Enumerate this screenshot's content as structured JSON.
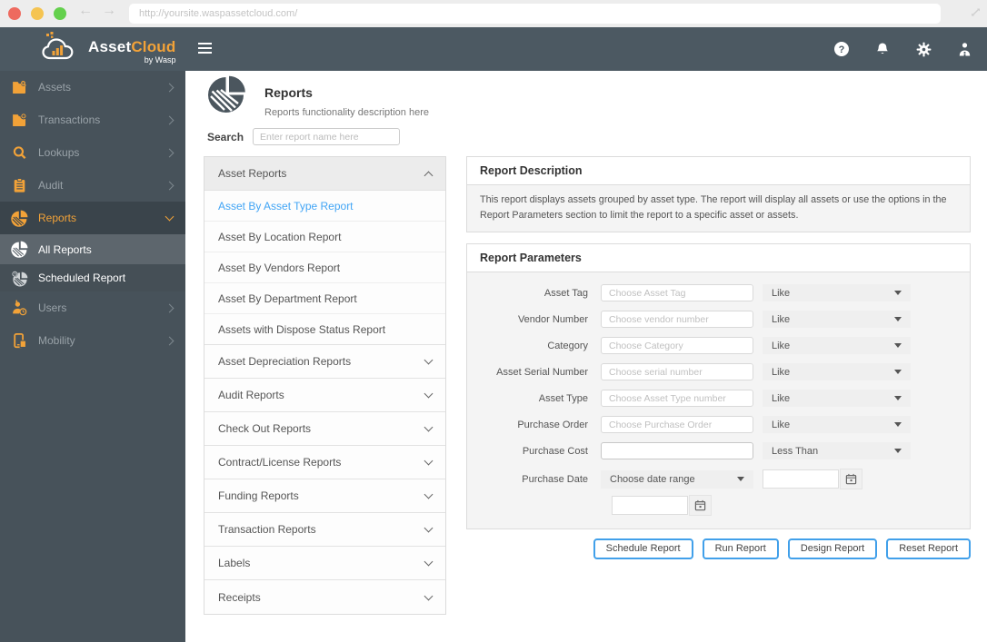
{
  "browser": {
    "url": "http://yoursite.waspassetcloud.com/"
  },
  "brand": {
    "name_primary": "Asset",
    "name_secondary": "Cloud",
    "tagline": "by Wasp"
  },
  "colors": {
    "accent_orange": "#f2a238",
    "link_blue": "#42a5f5",
    "button_border_blue": "#41a0ea",
    "appbar_bg": "#4c5962",
    "sidebar_bg": "#47525a"
  },
  "appbar_icons": [
    "help-icon",
    "notifications-bell-icon",
    "settings-gear-icon",
    "account-user-icon"
  ],
  "sidebar": {
    "items": [
      {
        "label": "Assets",
        "icon": "folder-search",
        "chevron": "right"
      },
      {
        "label": "Transactions",
        "icon": "folder-plus",
        "chevron": "right"
      },
      {
        "label": "Lookups",
        "icon": "magnifier",
        "chevron": "right"
      },
      {
        "label": "Audit",
        "icon": "clipboard",
        "chevron": "right"
      },
      {
        "label": "Reports",
        "icon": "pie-chart",
        "chevron": "down",
        "state": "active"
      },
      {
        "label": "All Reports",
        "icon": "pie-chart",
        "state": "selected-sub"
      },
      {
        "label": "Scheduled Report",
        "icon": "pie-chart-clock",
        "state": "sub"
      },
      {
        "label": "Users",
        "icon": "user-clock",
        "chevron": "right"
      },
      {
        "label": "Mobility",
        "icon": "mobile-device",
        "chevron": "right"
      }
    ]
  },
  "page": {
    "title": "Reports",
    "subtitle": "Reports functionality description here",
    "search_label": "Search",
    "search_placeholder": "Enter report name here"
  },
  "report_list": {
    "groups": [
      {
        "label": "Asset Reports",
        "expanded": true,
        "items": [
          "Asset By Asset Type Report",
          "Asset By Location Report",
          "Asset By Vendors Report",
          "Asset By Department Report",
          "Assets with Dispose Status Report"
        ],
        "selected_item": "Asset By Asset Type Report"
      },
      {
        "label": "Asset Depreciation Reports",
        "expanded": false
      },
      {
        "label": "Audit Reports",
        "expanded": false
      },
      {
        "label": "Check Out Reports",
        "expanded": false
      },
      {
        "label": "Contract/License Reports",
        "expanded": false
      },
      {
        "label": "Funding Reports",
        "expanded": false
      },
      {
        "label": "Transaction Reports",
        "expanded": false
      },
      {
        "label": "Labels",
        "expanded": false
      },
      {
        "label": "Receipts",
        "expanded": false
      }
    ]
  },
  "description_panel": {
    "title": "Report Description",
    "body": "This report displays assets grouped by asset type. The report will display all assets or use the options in the Report Parameters section to limit the report to a specific asset or assets."
  },
  "parameters_panel": {
    "title": "Report Parameters",
    "fields": [
      {
        "label": "Asset Tag",
        "placeholder": "Choose Asset Tag",
        "operator": "Like"
      },
      {
        "label": "Vendor Number",
        "placeholder": "Choose vendor number",
        "operator": "Like"
      },
      {
        "label": "Category",
        "placeholder": "Choose Category",
        "operator": "Like"
      },
      {
        "label": "Asset Serial Number",
        "placeholder": "Choose serial number",
        "operator": "Like"
      },
      {
        "label": "Asset Type",
        "placeholder": "Choose Asset Type number",
        "operator": "Like"
      },
      {
        "label": "Purchase Order",
        "placeholder": "Choose Purchase Order",
        "operator": "Like"
      },
      {
        "label": "Purchase Cost",
        "placeholder": "",
        "operator": "Less Than"
      },
      {
        "label": "Purchase Date",
        "range_placeholder": "Choose date range",
        "date_from": "",
        "date_to": ""
      }
    ]
  },
  "actions": {
    "buttons": [
      "Schedule Report",
      "Run Report",
      "Design Report",
      "Reset Report"
    ]
  }
}
